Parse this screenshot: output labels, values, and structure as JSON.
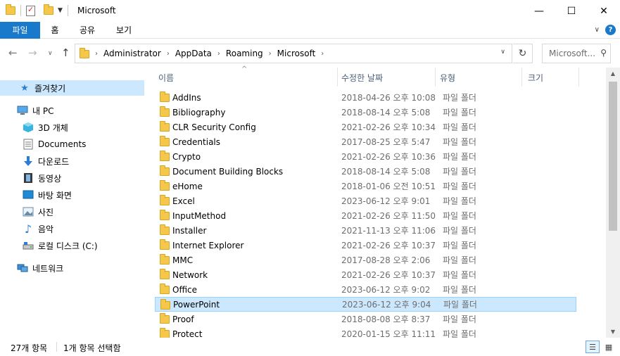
{
  "window": {
    "title": "Microsoft",
    "minimize_glyph": "—",
    "maximize_glyph": "☐",
    "close_glyph": "✕"
  },
  "ribbon": {
    "file_tab": "파일",
    "tabs": [
      "홈",
      "공유",
      "보기"
    ],
    "collapse_glyph": "∨",
    "help_glyph": "?"
  },
  "nav": {
    "back_glyph": "←",
    "forward_glyph": "→",
    "recent_glyph": "∨",
    "up_glyph": "↑",
    "breadcrumbs": [
      "Administrator",
      "AppData",
      "Roaming",
      "Microsoft"
    ],
    "crumb_separator": "›",
    "dropdown_glyph": "∨",
    "refresh_glyph": "↻",
    "search_placeholder": "Microsoft...",
    "search_glyph": "⚲"
  },
  "sidebar": {
    "quick_access": "즐겨찾기",
    "this_pc": "내 PC",
    "items": [
      "3D 개체",
      "Documents",
      "다운로드",
      "동영상",
      "바탕 화면",
      "사진",
      "음악",
      "로컬 디스크 (C:)"
    ],
    "network": "네트워크"
  },
  "columns": {
    "name": "이름",
    "date": "수정한 날짜",
    "type": "유형",
    "size": "크기",
    "sort_glyph": "^"
  },
  "files": [
    {
      "name": "AddIns",
      "date": "2018-04-26 오후 10:08",
      "type": "파일 폴더"
    },
    {
      "name": "Bibliography",
      "date": "2018-08-14 오후 5:08",
      "type": "파일 폴더"
    },
    {
      "name": "CLR Security Config",
      "date": "2021-02-26 오후 10:34",
      "type": "파일 폴더"
    },
    {
      "name": "Credentials",
      "date": "2017-08-25 오후 5:47",
      "type": "파일 폴더"
    },
    {
      "name": "Crypto",
      "date": "2021-02-26 오후 10:36",
      "type": "파일 폴더"
    },
    {
      "name": "Document Building Blocks",
      "date": "2018-08-14 오후 5:08",
      "type": "파일 폴더"
    },
    {
      "name": "eHome",
      "date": "2018-01-06 오전 10:51",
      "type": "파일 폴더"
    },
    {
      "name": "Excel",
      "date": "2023-06-12 오후 9:01",
      "type": "파일 폴더"
    },
    {
      "name": "InputMethod",
      "date": "2021-02-26 오후 11:50",
      "type": "파일 폴더"
    },
    {
      "name": "Installer",
      "date": "2021-11-13 오후 11:06",
      "type": "파일 폴더"
    },
    {
      "name": "Internet Explorer",
      "date": "2021-02-26 오후 10:37",
      "type": "파일 폴더"
    },
    {
      "name": "MMC",
      "date": "2017-08-28 오후 2:06",
      "type": "파일 폴더"
    },
    {
      "name": "Network",
      "date": "2021-02-26 오후 10:37",
      "type": "파일 폴더"
    },
    {
      "name": "Office",
      "date": "2023-06-12 오후 9:02",
      "type": "파일 폴더"
    },
    {
      "name": "PowerPoint",
      "date": "2023-06-12 오후 9:04",
      "type": "파일 폴더",
      "selected": true
    },
    {
      "name": "Proof",
      "date": "2018-08-08 오후 8:37",
      "type": "파일 폴더"
    },
    {
      "name": "Protect",
      "date": "2020-01-15 오후 11:11",
      "type": "파일 폴더"
    }
  ],
  "scrollbar": {
    "up_glyph": "▲",
    "down_glyph": "▼"
  },
  "status": {
    "item_count": "27개 항목",
    "selection": "1개 항목 선택함",
    "details_view_glyph": "☰",
    "icons_view_glyph": "▦"
  },
  "colors": {
    "accent": "#1979ca",
    "selection": "#cce8ff",
    "folder": "#f5c84c"
  }
}
